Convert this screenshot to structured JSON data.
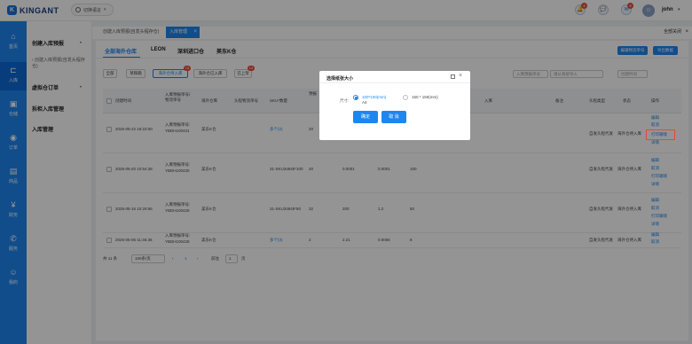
{
  "header": {
    "logo_mark": "K",
    "logo_text": "KINGANT",
    "language_label": "切换语言",
    "notifications": [
      {
        "name": "bell-icon",
        "glyph": "🔔",
        "badge": "4"
      },
      {
        "name": "chat-icon",
        "glyph": "💬",
        "badge": ""
      },
      {
        "name": "message-icon",
        "glyph": "✉",
        "badge": "4"
      }
    ],
    "user_name": "john"
  },
  "nav": {
    "items": [
      {
        "label": "首页",
        "icon": "home-icon",
        "glyph": "⌂"
      },
      {
        "label": "入库",
        "icon": "inbound-icon",
        "glyph": "⊏"
      },
      {
        "label": "仓储",
        "icon": "warehouse-icon",
        "glyph": "▣"
      },
      {
        "label": "订单",
        "icon": "order-icon",
        "glyph": "◉"
      },
      {
        "label": "商品",
        "icon": "goods-icon",
        "glyph": "▤"
      },
      {
        "label": "财务",
        "icon": "finance-icon",
        "glyph": "¥"
      },
      {
        "label": "服务",
        "icon": "service-icon",
        "glyph": "✆"
      },
      {
        "label": "我的",
        "icon": "user-icon",
        "glyph": "☺"
      }
    ]
  },
  "submenu": {
    "create_forecast": "创建入库预报",
    "create_forecast_sub": "› 创建入库预报(自发头程存仓)",
    "virtual_order": "虚拟仓订单",
    "split_inbound": "拆柜入库管理",
    "inbound_manage": "入库管理"
  },
  "page_tabs": {
    "tab1": "创建入库预报(自发头程存仓)",
    "tab2": "入库管理",
    "close_all": "全部关闭"
  },
  "warehouse_tabs": [
    "全部海外仓库",
    "LEON",
    "深圳进口仓",
    "美东K仓"
  ],
  "actions": {
    "edit_tracking": "编辑物流单号",
    "export_data": "导出数据"
  },
  "status_tabs": [
    {
      "label": "全部",
      "badge": ""
    },
    {
      "label": "草稿箱",
      "badge": ""
    },
    {
      "label": "海外仓待入库",
      "badge": "15"
    },
    {
      "label": "海外仓已入库",
      "badge": ""
    },
    {
      "label": "已上架",
      "badge": "14"
    }
  ],
  "filters": {
    "forecast_no": "入库预报单号",
    "forecast_no_ph": "请从系统导入",
    "created_time": "创建时间"
  },
  "table": {
    "headers": {
      "created": "创建时间",
      "forecast_no": "入库预报单号/物流单号",
      "warehouse": "海外仓库",
      "head_tracking": "头程物流单号",
      "sku_qty": "SKU*数量",
      "forecast": "预报",
      "inbound": "入库",
      "remark": "备注",
      "type": "头程类型",
      "status": "状态",
      "ops": "操作"
    },
    "rows": [
      {
        "time": "2025-05-22 16:23:00",
        "no_label": "入库预报单号:",
        "no": "YBDH100431",
        "wh": "美东K仓",
        "sku": "多个(2)",
        "qty": "20",
        "v1": "",
        "v2": "",
        "v3": "",
        "type": "自发头程代发",
        "status": "海外仓待入库",
        "ops": [
          "编辑",
          "取消",
          "打印箱唛",
          "详情"
        ]
      },
      {
        "time": "2025-05-20 10:54:38",
        "no_label": "入库预报单号:",
        "no": "YBDH100430",
        "wh": "美东K仓",
        "sku": "31-SKU34845*100",
        "qty": "20",
        "v1": "0.0001",
        "v2": "0.0001",
        "v3": "100",
        "type": "自发头程代发",
        "status": "海外仓待入库",
        "ops": [
          "编辑",
          "取消",
          "打印箱唛",
          "详情"
        ]
      },
      {
        "time": "2025-05-16 10:29:56",
        "no_label": "入库预报单号:",
        "no": "YBDH100429",
        "wh": "美东K仓",
        "sku": "31-SKU34845*50",
        "qty": "32",
        "v1": "200",
        "v2": "1.2",
        "v3": "50",
        "type": "自发头程代发",
        "status": "海外仓待入库",
        "ops": [
          "编辑",
          "取消",
          "打印箱唛",
          "详情"
        ]
      },
      {
        "time": "2025-05-06 11:46:36",
        "no_label": "入库预报单号:",
        "no": "YBDH100428",
        "wh": "美东K仓",
        "sku": "多个(3)",
        "qty": "2",
        "v1": "2.21",
        "v2": "0.0065",
        "v3": "8",
        "type": "自发头程代发",
        "status": "海外仓待入库",
        "ops": [
          "编辑",
          "取消",
          "打印箱唛",
          "详情"
        ]
      }
    ]
  },
  "pager": {
    "total": "共 11 条",
    "page_size": "100条/页",
    "prev": "‹",
    "current": "1",
    "next": "›",
    "goto": "前往",
    "goto_value": "1",
    "page_unit": "页"
  },
  "modal": {
    "title": "选择纸张大小",
    "size_label": "尺寸:",
    "option1": "100*100(mm)",
    "option1_sub": "A4",
    "option2": "150 * 150(mm)",
    "confirm": "确定",
    "cancel": "取 消"
  }
}
